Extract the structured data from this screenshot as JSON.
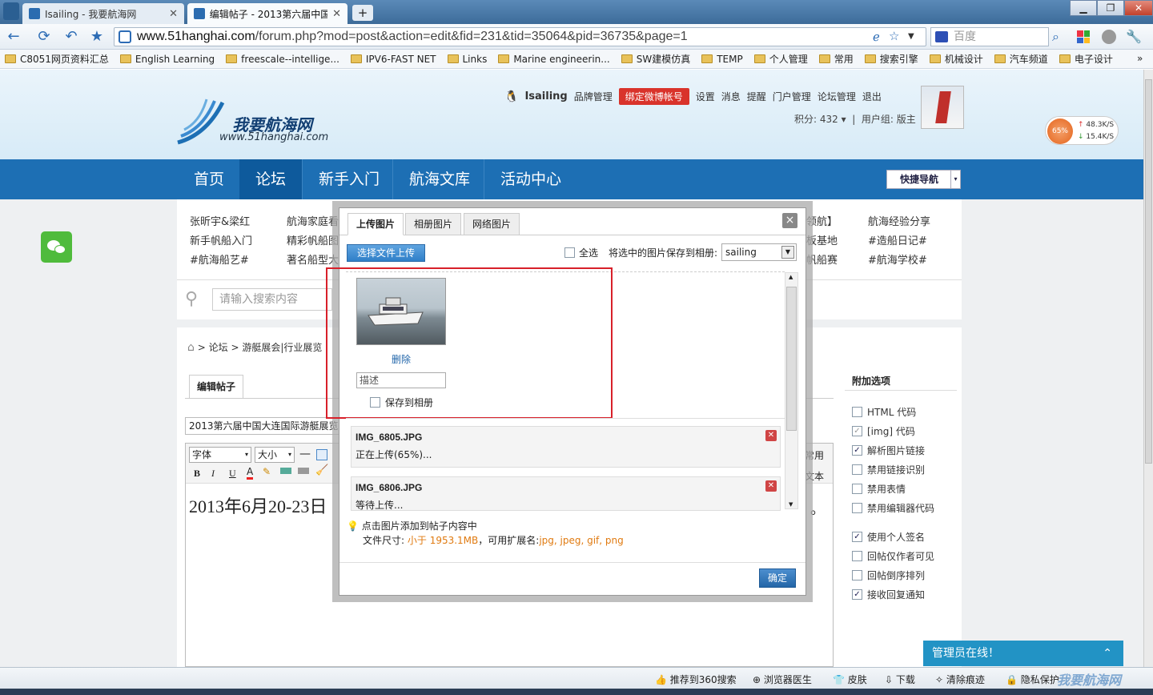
{
  "browser": {
    "tabs": [
      {
        "label": "Isailing - 我要航海网"
      },
      {
        "label": "编辑帖子 - 2013第六届中国大"
      }
    ],
    "new_tab": "+",
    "url_host": "www.51hanghai.com",
    "url_path": "/forum.php?mod=post&action=edit&fid=231&tid=35064&pid=36735&page=1",
    "search_placeholder": "百度",
    "bookmarks": [
      "C8051网页资料汇总",
      "English Learning",
      "freescale--intellige...",
      "IPV6-FAST NET",
      "Links",
      "Marine engineerin...",
      "SW建模仿真",
      "TEMP",
      "个人管理",
      "常用",
      "搜索引擎",
      "机械设计",
      "汽车频道",
      "电子设计"
    ],
    "more": "»"
  },
  "site": {
    "logo_name": "我要航海网",
    "logo_url": "www.51hanghai.com",
    "user": {
      "name": "Isailing",
      "brand_mgmt": "品牌管理",
      "weibo_button": "绑定微博帐号",
      "links": [
        "设置",
        "消息",
        "提醒",
        "门户管理",
        "论坛管理",
        "退出"
      ],
      "points": "积分: 432",
      "group": "用户组: 版主"
    },
    "netmon": {
      "percent": "65%",
      "up": "48.3K/S",
      "down": "15.4K/S"
    },
    "nav": [
      "首页",
      "论坛",
      "新手入门",
      "航海文库",
      "活动中心"
    ],
    "quick_nav": "快捷导航",
    "topics_col1": [
      "张昕宇&梁红",
      "新手帆船入门",
      "#航海船艺#"
    ],
    "topics_col2": [
      "航海家庭看",
      "精彩帆船图",
      "著名船型大"
    ],
    "topics_col3": [
      "领航】",
      "板基地",
      "帆船赛"
    ],
    "topics_col4": [
      "航海经验分享",
      "#造船日记#",
      "#航海学校#"
    ],
    "search_placeholder": "请输入搜索内容",
    "breadcrumb": {
      "home_sep": ">",
      "forum": "论坛",
      "sep": ">",
      "board": "游艇展会|行业展览"
    },
    "edit_tab": "编辑帖子",
    "post_title": "2013第六届中国大连国际游艇展览会",
    "editor": {
      "font": "字体",
      "size": "大小",
      "common": "常用",
      "text_label": "文本",
      "body": "2013年6月20-23日",
      "tail": "。",
      "format_bold": "B",
      "format_italic": "I",
      "format_underline": "U",
      "format_color": "A"
    },
    "options_title": "附加选项",
    "options": [
      {
        "label": "HTML 代码",
        "checked": false
      },
      {
        "label": "[img] 代码",
        "checked": true
      },
      {
        "label": "解析图片链接",
        "checked": true
      },
      {
        "label": "禁用链接识别",
        "checked": false
      },
      {
        "label": "禁用表情",
        "checked": false
      },
      {
        "label": "禁用编辑器代码",
        "checked": false
      },
      {
        "label": "使用个人签名",
        "checked": true
      },
      {
        "label": "回帖仅作者可见",
        "checked": false
      },
      {
        "label": "回帖倒序排列",
        "checked": false
      },
      {
        "label": "接收回复通知",
        "checked": true
      }
    ],
    "admin_online": "管理员在线！",
    "admin_chevron": "⌃"
  },
  "dialog": {
    "tabs": [
      "上传图片",
      "相册图片",
      "网络图片"
    ],
    "close": "×",
    "upload_button": "选择文件上传",
    "select_all": "全选",
    "save_to_album_label": "将选中的图片保存到相册:",
    "album_value": "sailing",
    "thumb_delete": "删除",
    "desc_placeholder": "描述",
    "save_to_album_cb": "保存到相册",
    "files": [
      {
        "name": "IMG_6805.JPG",
        "status": "正在上传(65%)..."
      },
      {
        "name": "IMG_6806.JPG",
        "status": "等待上传..."
      }
    ],
    "tip_line1": "点击图片添加到帖子内容中",
    "tip_size_label": "文件尺寸:",
    "tip_size_value": "小于 1953.1MB",
    "tip_ext_label": "，可用扩展名:",
    "tip_ext_value": "jpg, jpeg, gif, png",
    "ok": "确定"
  },
  "statusbar": [
    "推荐到360搜索",
    "浏览器医生",
    "皮肤",
    "下载",
    "清除痕迹",
    "隐私保护"
  ],
  "watermark": "我要航海网"
}
